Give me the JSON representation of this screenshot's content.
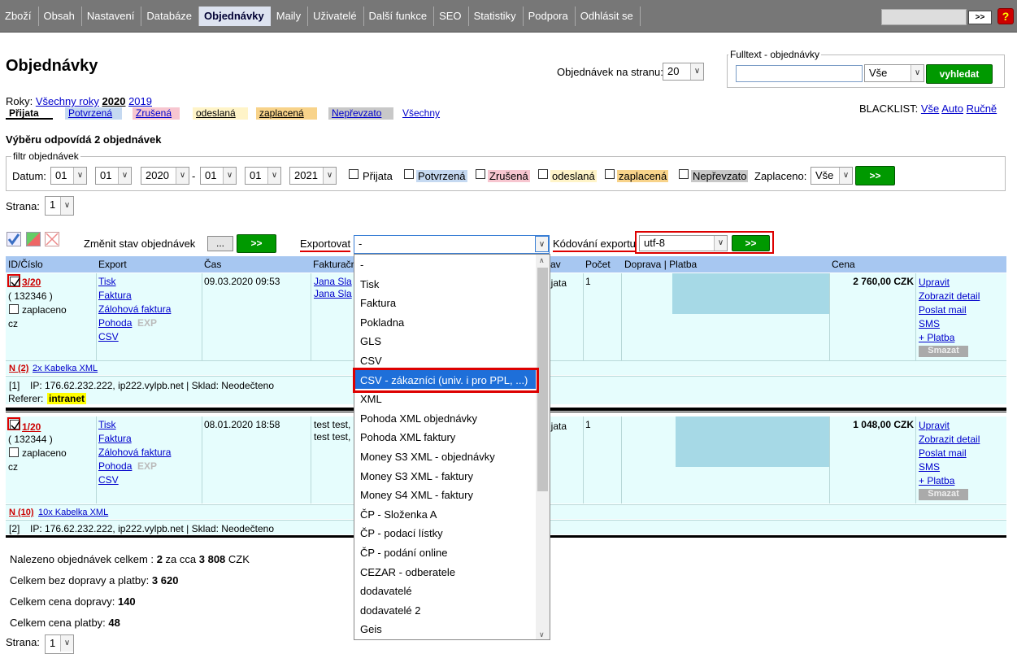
{
  "nav": {
    "items": [
      "Zboží",
      "Obsah",
      "Nastavení",
      "Databáze",
      "Objednávky",
      "Maily",
      "Uživatelé",
      "Další funkce",
      "SEO",
      "Statistiky",
      "Podpora",
      "Odhlásit se"
    ],
    "active": "Objednávky",
    "go": ">>",
    "help": "?"
  },
  "page": {
    "title": "Objednávky"
  },
  "perpage": {
    "label": "Objednávek na stranu:",
    "value": "20"
  },
  "fulltext": {
    "legend": "Fulltext - objednávky",
    "value": "",
    "scope": "Vše",
    "button": "vyhledat"
  },
  "years": {
    "label": "Roky:",
    "all": "Všechny roky",
    "y2020": "2020",
    "y2019": "2019"
  },
  "statuses": {
    "prijata": "Přijata",
    "potvrzena": "Potvrzená",
    "zrusena": "Zrušená",
    "odeslana": "odeslaná",
    "zaplacena": "zaplacená",
    "neprevzato": "Nepřevzato",
    "vsechny": "Všechny"
  },
  "status_colors": {
    "prijata": "#ffffff",
    "potvrzena": "#c5d9f1",
    "zrusena": "#f7c6d0",
    "odeslana": "#fff4c8",
    "zaplacena": "#f8d38a",
    "neprevzato": "#c8c8c8"
  },
  "blacklist": {
    "label": "BLACKLIST:",
    "vse": "Vše",
    "auto": "Auto",
    "rucne": "Ručně"
  },
  "match": "Výběru odpovídá 2 objednávek",
  "filter": {
    "legend": "filtr objednávek",
    "datum": "Datum:",
    "d1": "01",
    "m1": "01",
    "y1": "2020",
    "dash": "-",
    "d2": "01",
    "m2": "01",
    "y2": "2021",
    "zaplaceno": "Zaplaceno:",
    "zaplaceno_val": "Vše",
    "go": ">>"
  },
  "strana": {
    "label": "Strana:",
    "value": "1"
  },
  "actions": {
    "change_label": "Změnit stav objednávek",
    "dots": "...",
    "go": ">>",
    "export_label": "Exportovat",
    "export_value": "-",
    "encoding_label": "Kódování exportu",
    "encoding_value": "utf-8",
    "go2": ">>"
  },
  "table": {
    "headers": [
      "ID/Číslo",
      "Export",
      "Čas",
      "Fakturační",
      "av",
      "Počet",
      "Doprava | Platba",
      "Cena"
    ],
    "orders": [
      {
        "id": "3/20",
        "num": "( 132346 )",
        "paid": "zaplaceno",
        "lang": "cz",
        "exports": [
          "Tisk",
          "Faktura",
          "Zálohová faktura",
          "Pohoda"
        ],
        "exp": "EXP",
        "csv": "CSV",
        "time": "09.03.2020 09:53",
        "bill1": "Jana Sla",
        "bill2": "Jana Sla",
        "state": "ijata",
        "count": "1",
        "price": "2 760,00 CZK",
        "acts": [
          "Upravit",
          "Zobrazit detail",
          "Poslat mail",
          "SMS",
          "+ Platba"
        ],
        "delete": "Smazat",
        "item_n": "N (2)",
        "item": "2x Kabelka XML",
        "info_idx": "[1]",
        "info": "IP: 176.62.232.222, ip222.vylpb.net | Sklad: Neodečteno",
        "referer_label": "Referer:",
        "referer": "intranet"
      },
      {
        "id": "1/20",
        "num": "( 132344 )",
        "paid": "zaplaceno",
        "lang": "cz",
        "exports": [
          "Tisk",
          "Faktura",
          "Zálohová faktura",
          "Pohoda"
        ],
        "exp": "EXP",
        "csv": "CSV",
        "time": "08.01.2020 18:58",
        "bill1": "test test,",
        "bill2": "test test,",
        "state": "ijata",
        "count": "1",
        "price": "1 048,00 CZK",
        "acts": [
          "Upravit",
          "Zobrazit detail",
          "Poslat mail",
          "SMS",
          "+ Platba"
        ],
        "delete": "Smazat",
        "item_n": "N (10)",
        "item": "10x Kabelka XML",
        "info_idx": "[2]",
        "info": "IP: 176.62.232.222, ip222.vylpb.net | Sklad: Neodečteno"
      }
    ]
  },
  "summary": {
    "total_label": "Nalezeno objednávek celkem :",
    "total_count": "2",
    "total_mid": "za cca",
    "total_sum": "3 808",
    "total_cur": "CZK",
    "bez_label": "Celkem bez dopravy a platby:",
    "bez": "3 620",
    "doprava_label": "Celkem cena dopravy:",
    "doprava": "140",
    "platba_label": "Celkem cena platby:",
    "platba": "48",
    "strana_label": "Strana:",
    "strana_val": "1"
  },
  "dropdown": {
    "options": [
      "-",
      "Tisk",
      "Faktura",
      "Pokladna",
      "GLS",
      "CSV",
      "CSV - zákazníci (univ. i pro PPL, ...)",
      "XML",
      "Pohoda XML objednávky",
      "Pohoda XML faktury",
      "Money S3 XML - objednávky",
      "Money S3 XML - faktury",
      "Money S4 XML - faktury",
      "ČP - Složenka A",
      "ČP - podací lístky",
      "ČP - podání online",
      "CEZAR - odberatele",
      "dodavatelé",
      "dodavatelé 2",
      "Geis"
    ],
    "highlighted_index": 6
  }
}
